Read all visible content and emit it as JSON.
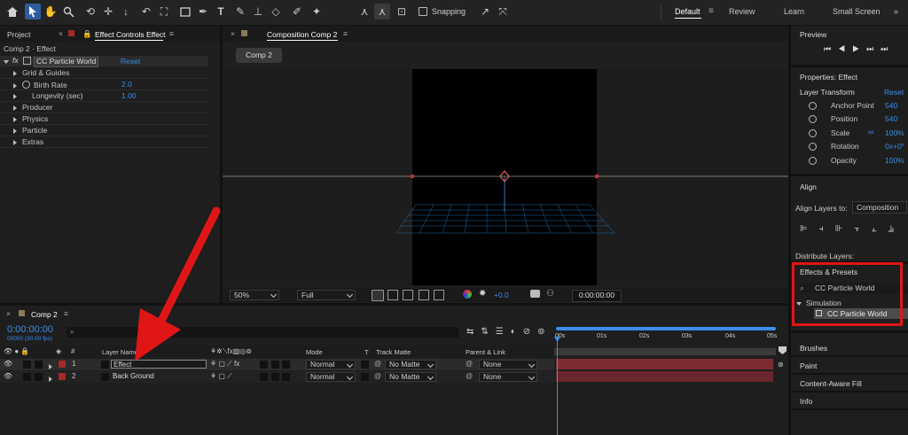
{
  "colors": {
    "accent": "#3b8eea",
    "highlight_red": "#e01616",
    "layer_bar": "#7c2b33",
    "playhead": "#3b8eea"
  },
  "toolbar": {
    "tools": [
      "home-icon",
      "selection-tool-icon",
      "hand-tool-icon",
      "zoom-tool-icon",
      "orbit-camera-icon",
      "pan-camera-icon",
      "dolly-camera-icon",
      "rotate-tool-icon",
      "pan-behind-tool-icon",
      "rectangle-tool-icon",
      "pen-tool-icon",
      "type-tool-icon",
      "brush-tool-icon",
      "clone-stamp-icon",
      "eraser-tool-icon",
      "roto-brush-icon",
      "puppet-tool-icon"
    ],
    "snapping_label": "Snapping",
    "workspaces": [
      "Default",
      "Review",
      "Learn",
      "Small Screen"
    ],
    "more": "»"
  },
  "left_panel": {
    "tab_project": "Project",
    "tab_effect_controls": "Effect Controls Effect",
    "breadcrumb": "Comp 2 · Effect",
    "effect_name": "CC Particle World",
    "reset": "Reset",
    "fx": "fx",
    "rows": [
      {
        "label": "Grid & Guides",
        "value": ""
      },
      {
        "label": "Birth Rate",
        "value": "2.0"
      },
      {
        "label": "Longevity (sec)",
        "value": "1.00"
      },
      {
        "label": "Producer",
        "value": ""
      },
      {
        "label": "Physics",
        "value": ""
      },
      {
        "label": "Particle",
        "value": ""
      },
      {
        "label": "Extras",
        "value": ""
      }
    ]
  },
  "composition": {
    "tab": "Composition Comp 2",
    "comp_button": "Comp 2",
    "zoom": "50%",
    "resolution": "Full",
    "exposure": "+0.0",
    "timecode": "0:00:00:00"
  },
  "right_panel": {
    "preview_title": "Preview",
    "properties_title": "Properties: Effect",
    "layer_transform": "Layer Transform",
    "reset": "Reset",
    "props": [
      {
        "name": "Anchor Point",
        "value": "540"
      },
      {
        "name": "Position",
        "value": "540"
      },
      {
        "name": "Scale",
        "value": "100%"
      },
      {
        "name": "Rotation",
        "value": "0x+0°"
      },
      {
        "name": "Opacity",
        "value": "100%"
      }
    ],
    "align_title": "Align",
    "align_to_label": "Align Layers to:",
    "align_to_value": "Composition",
    "distribute_label": "Distribute Layers:",
    "effects_presets_title": "Effects & Presets",
    "search_value": "CC Particle World",
    "category": "Simulation",
    "result": "CC Particle World",
    "panels": [
      "Brushes",
      "Paint",
      "Content-Aware Fill",
      "Info"
    ]
  },
  "timeline": {
    "tab": "Comp 2",
    "timecode": "0:00:00:00",
    "fps": "00000 (30.00 fps)",
    "col_num": "#",
    "col_layer_name": "Layer Name",
    "col_mode": "Mode",
    "col_t": "T",
    "col_track_matte": "Track Matte",
    "col_parent": "Parent & Link",
    "ruler": [
      "00s",
      "01s",
      "02s",
      "03s",
      "04s",
      "05s"
    ],
    "layers": [
      {
        "num": "1",
        "name": "Effect",
        "mode": "Normal",
        "matte": "No Matte",
        "parent": "None"
      },
      {
        "num": "2",
        "name": "Back Ground",
        "mode": "Normal",
        "matte": "No Matte",
        "parent": "None"
      }
    ]
  }
}
